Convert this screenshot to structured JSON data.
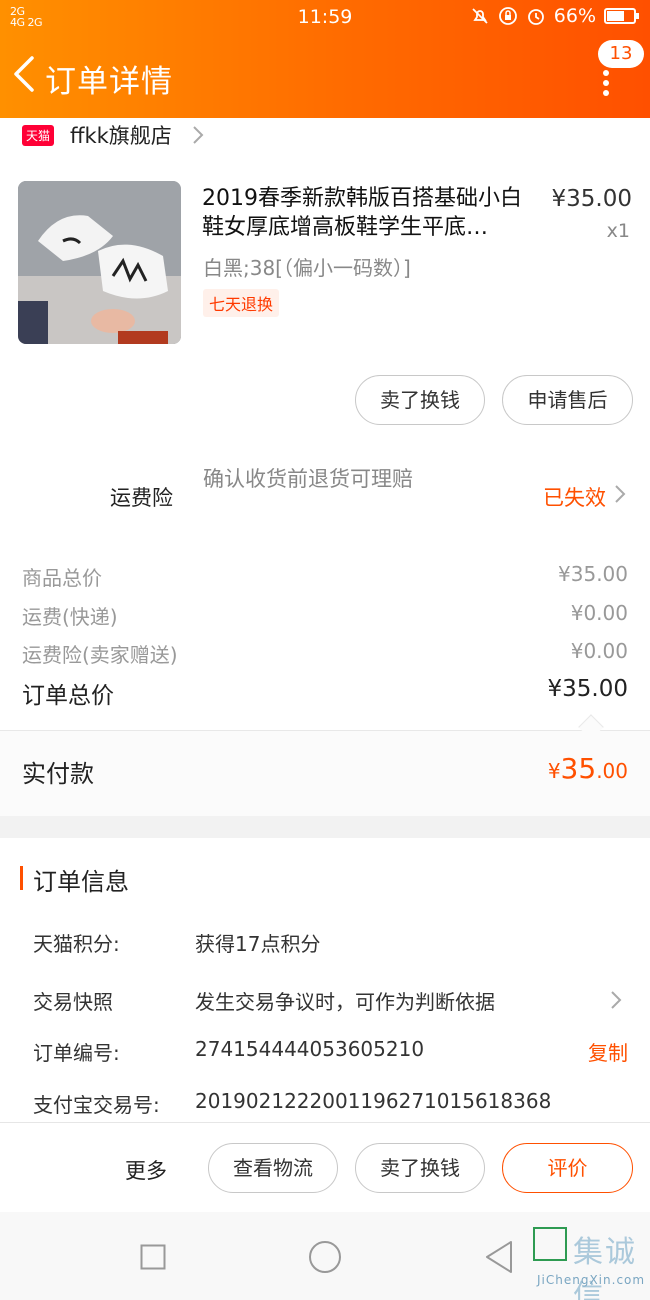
{
  "status_bar": {
    "signal_1": "2G",
    "signal_2": "4G 2G",
    "time": "11:59",
    "battery": "66%",
    "battery_level": 0.66
  },
  "header": {
    "title": "订单详情",
    "badge_count": "13"
  },
  "shop": {
    "platform_tag": "天猫",
    "name": "ffkk旗舰店"
  },
  "product": {
    "title": "2019春季新款韩版百搭基础小白鞋女厚底增高板鞋学生平底…",
    "price": "¥35.00",
    "qty": "x1",
    "sku": "白黑;38[（偏小一码数）]",
    "tag": "七天退换"
  },
  "item_actions": {
    "sell_label": "卖了换钱",
    "aftersale_label": "申请售后"
  },
  "insurance": {
    "label": "运费险",
    "desc": "确认收货前退货可理赔",
    "status": "已失效"
  },
  "fees": [
    {
      "label": "商品总价",
      "value": "¥35.00"
    },
    {
      "label": "运费(快递)",
      "value": "¥0.00"
    },
    {
      "label": "运费险(卖家赠送)",
      "value": "¥0.00"
    }
  ],
  "total": {
    "label": "订单总价",
    "value": "¥35.00"
  },
  "paid": {
    "label": "实付款",
    "currency": "¥",
    "integer": "35",
    "decimal": ".00"
  },
  "order_info": {
    "title": "订单信息",
    "rows": [
      {
        "key": "天猫积分:",
        "value": "获得17点积分"
      },
      {
        "key": "交易快照",
        "value": "发生交易争议时，可作为判断依据"
      },
      {
        "key": "订单编号:",
        "value": "274154444053605210",
        "action": "复制"
      },
      {
        "key": "支付宝交易号:",
        "value": "2019021222001196271015618368"
      }
    ]
  },
  "bottom_actions": {
    "more": "更多",
    "logistics": "查看物流",
    "sell": "卖了换钱",
    "review": "评价"
  },
  "watermark": {
    "text": "集诚信",
    "url": "JiChengXin.com"
  },
  "colors": {
    "accent": "#ff5000",
    "header_start": "#ff9000",
    "tmall": "#ff0036"
  },
  "icons": [
    "back-icon",
    "more-dots-icon",
    "chevron-right-icon",
    "square-nav-icon",
    "circle-nav-icon",
    "triangle-back-nav-icon"
  ]
}
